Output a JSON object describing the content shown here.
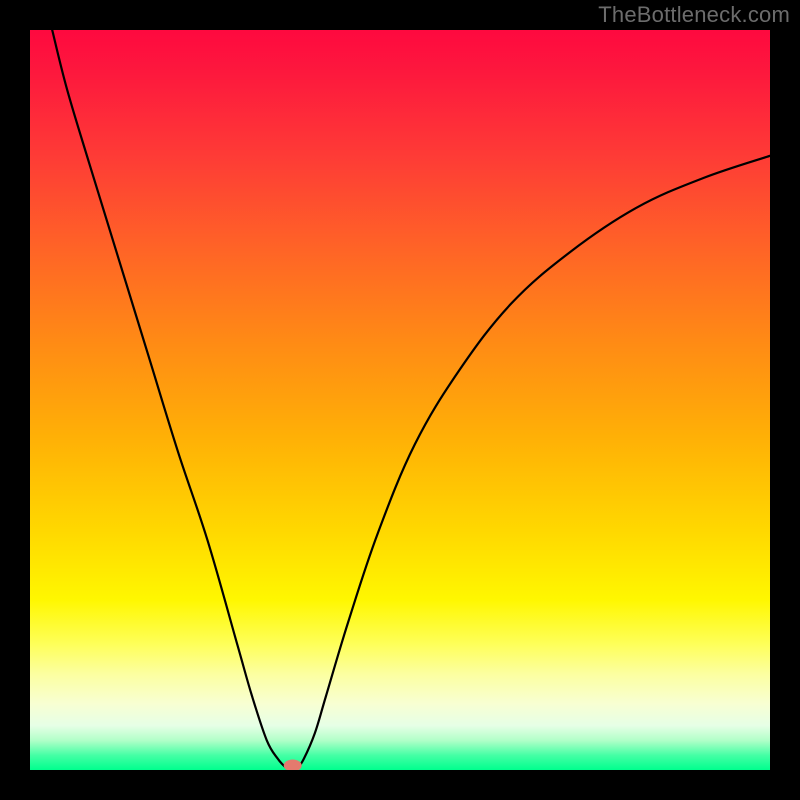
{
  "watermark": "TheBottleneck.com",
  "chart_data": {
    "type": "line",
    "title": "",
    "xlabel": "",
    "ylabel": "",
    "xlim": [
      0,
      100
    ],
    "ylim": [
      0,
      100
    ],
    "grid": false,
    "legend": false,
    "series": [
      {
        "name": "left-branch",
        "x": [
          3,
          5,
          8,
          12,
          16,
          20,
          24,
          28,
          30,
          32,
          33.5,
          34.5,
          35
        ],
        "y": [
          100,
          92,
          82,
          69,
          56,
          43,
          31,
          17,
          10,
          4,
          1.5,
          0.4,
          0
        ]
      },
      {
        "name": "right-branch",
        "x": [
          36,
          37,
          38.5,
          40,
          43,
          47,
          52,
          58,
          65,
          73,
          82,
          91,
          100
        ],
        "y": [
          0,
          1.5,
          5,
          10,
          20,
          32,
          44,
          54,
          63,
          70,
          76,
          80,
          83
        ]
      }
    ],
    "minimum_marker": {
      "x": 35.5,
      "y": 0.2
    },
    "background_gradient": {
      "orientation": "vertical",
      "stops": [
        {
          "pos": 0.0,
          "color": "#fe093f"
        },
        {
          "pos": 0.3,
          "color": "#ff6526"
        },
        {
          "pos": 0.68,
          "color": "#ffd900"
        },
        {
          "pos": 0.83,
          "color": "#feff5a"
        },
        {
          "pos": 0.94,
          "color": "#e6ffe6"
        },
        {
          "pos": 1.0,
          "color": "#00ff8e"
        }
      ]
    }
  }
}
